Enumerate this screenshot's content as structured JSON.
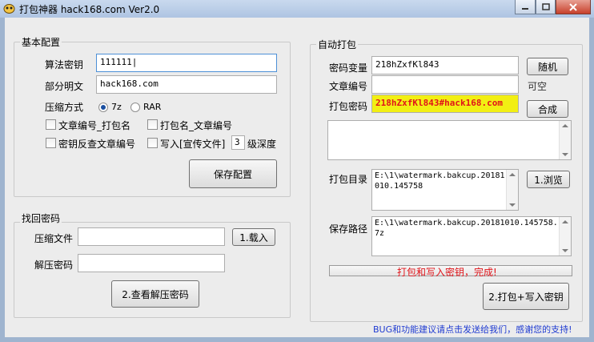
{
  "window": {
    "title": "打包神器 hack168.com Ver2.0"
  },
  "colors": {
    "status_red": "#e1141a",
    "footer_blue": "#1f3bd1",
    "highlight_yellow": "#f2ef13"
  },
  "basic_config": {
    "title": "基本配置",
    "algo_key_label": "算法密钥",
    "algo_key_value": "111111",
    "plain_label": "部分明文",
    "plain_value": "hack168.com",
    "compress_label": "压缩方式",
    "opt_7z": "7z",
    "opt_rar": "RAR",
    "selected": "7z",
    "chk_article_pack": "文章编号_打包名",
    "chk_pack_article": "打包名_文章编号",
    "chk_reverse_lookup": "密钥反查文章编号",
    "chk_write_promo": "写入[宣传文件]",
    "depth_value": "3",
    "depth_label": "级深度",
    "save_btn": "保存配置"
  },
  "retrieve": {
    "title": "找回密码",
    "file_label": "压缩文件",
    "load_btn": "1.载入",
    "pwd_label": "解压密码",
    "view_btn": "2.查看解压密码"
  },
  "auto_pack": {
    "title": "自动打包",
    "var_label": "密码变量",
    "var_value": "218hZxfKl843",
    "random_btn": "随机",
    "article_label": "文章编号",
    "optional_hint": "可空",
    "pack_pwd_label": "打包密码",
    "pack_pwd_value": "218hZxfKl843#hack168.com",
    "combine_btn": "合成",
    "dir_label": "打包目录",
    "dir_value": "E:\\1\\watermark.bakcup.20181010.145758",
    "browse_btn": "1.浏览",
    "save_path_label": "保存路径",
    "save_path_value": "E:\\1\\watermark.bakcup.20181010.145758.7z",
    "status_text": "打包和写入密钥，完成!",
    "pack_btn": "2.打包+写入密钥"
  },
  "footer": {
    "text": "BUG和功能建议请点击发送给我们，感谢您的支持!"
  }
}
